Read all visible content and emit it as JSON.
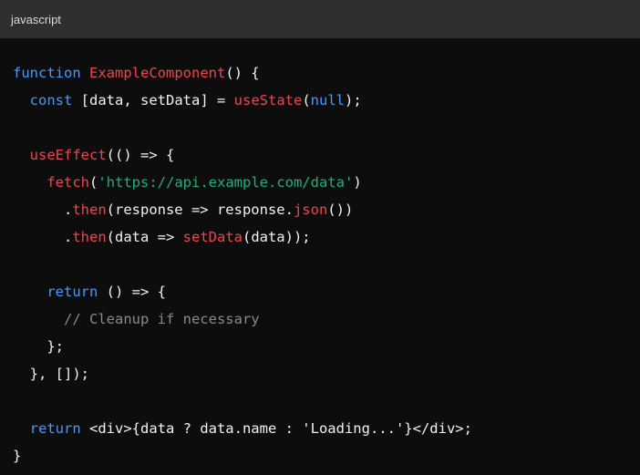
{
  "code_block": {
    "language": "javascript",
    "colors": {
      "background": "#0d0d0d",
      "header": "#2f2f2f",
      "keyword": "#3f9bff",
      "function": "#f0434f",
      "string": "#19b080",
      "comment": "#8a8a8a",
      "plain": "#f2f2f2"
    },
    "lines": [
      [
        {
          "t": "kw",
          "v": "function"
        },
        {
          "t": "pl",
          "v": " "
        },
        {
          "t": "fn",
          "v": "ExampleComponent"
        },
        {
          "t": "pl",
          "v": "() {"
        }
      ],
      [
        {
          "t": "pl",
          "v": "  "
        },
        {
          "t": "kw",
          "v": "const"
        },
        {
          "t": "pl",
          "v": " [data, setData] = "
        },
        {
          "t": "fn",
          "v": "useState"
        },
        {
          "t": "pl",
          "v": "("
        },
        {
          "t": "kw",
          "v": "null"
        },
        {
          "t": "pl",
          "v": ");"
        }
      ],
      [],
      [
        {
          "t": "pl",
          "v": "  "
        },
        {
          "t": "fn",
          "v": "useEffect"
        },
        {
          "t": "pl",
          "v": "(() => {"
        }
      ],
      [
        {
          "t": "pl",
          "v": "    "
        },
        {
          "t": "fn",
          "v": "fetch"
        },
        {
          "t": "pl",
          "v": "("
        },
        {
          "t": "str",
          "v": "'https://api.example.com/data'"
        },
        {
          "t": "pl",
          "v": ")"
        }
      ],
      [
        {
          "t": "pl",
          "v": "      ."
        },
        {
          "t": "fn",
          "v": "then"
        },
        {
          "t": "pl",
          "v": "(response => response."
        },
        {
          "t": "fn",
          "v": "json"
        },
        {
          "t": "pl",
          "v": "())"
        }
      ],
      [
        {
          "t": "pl",
          "v": "      ."
        },
        {
          "t": "fn",
          "v": "then"
        },
        {
          "t": "pl",
          "v": "(data => "
        },
        {
          "t": "fn",
          "v": "setData"
        },
        {
          "t": "pl",
          "v": "(data));"
        }
      ],
      [],
      [
        {
          "t": "pl",
          "v": "    "
        },
        {
          "t": "kw",
          "v": "return"
        },
        {
          "t": "pl",
          "v": " () => {"
        }
      ],
      [
        {
          "t": "pl",
          "v": "      "
        },
        {
          "t": "cm",
          "v": "// Cleanup if necessary"
        }
      ],
      [
        {
          "t": "pl",
          "v": "    };"
        }
      ],
      [
        {
          "t": "pl",
          "v": "  }, []);"
        }
      ],
      [],
      [
        {
          "t": "pl",
          "v": "  "
        },
        {
          "t": "kw",
          "v": "return"
        },
        {
          "t": "pl",
          "v": " <div>{data ? data.name : 'Loading...'}</div>;"
        }
      ],
      [
        {
          "t": "pl",
          "v": "}"
        }
      ]
    ]
  }
}
